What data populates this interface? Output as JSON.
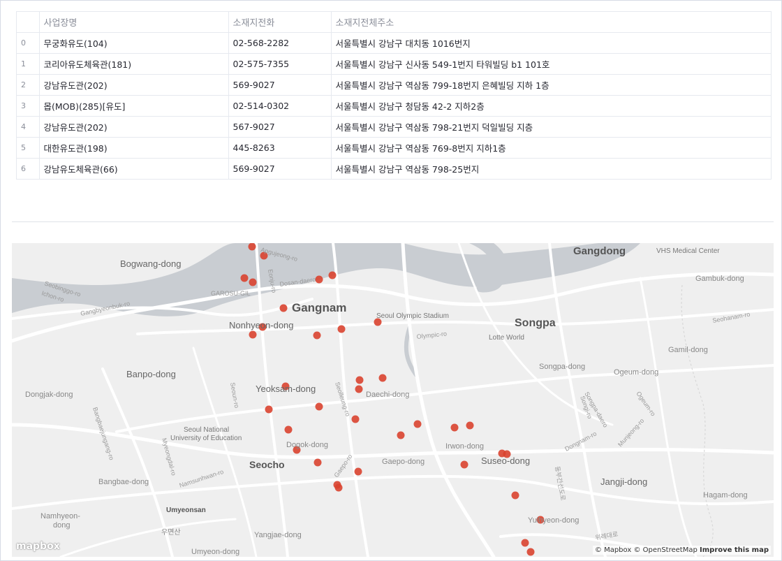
{
  "table": {
    "headers": [
      "",
      "사업장명",
      "소재지전화",
      "소재지전체주소"
    ],
    "rows": [
      {
        "idx": "0",
        "name": "무궁화유도(104)",
        "phone": "02-568-2282",
        "addr": "서울특별시 강남구 대치동 1016번지"
      },
      {
        "idx": "1",
        "name": "코리아유도체육관(181)",
        "phone": "02-575-7355",
        "addr": "서울특별시 강남구 신사동 549-1번지 타워빌딩 b1 101호"
      },
      {
        "idx": "2",
        "name": "강남유도관(202)",
        "phone": "569-9027",
        "addr": "서울특별시 강남구 역삼동 799-18번지 은혜빌딩 지하 1층"
      },
      {
        "idx": "3",
        "name": "몹(MOB)(285)[유도]",
        "phone": "02-514-0302",
        "addr": "서울특별시 강남구 청담동 42-2 지하2층"
      },
      {
        "idx": "4",
        "name": "강남유도관(202)",
        "phone": "567-9027",
        "addr": "서울특별시 강남구 역삼동 798-21번지 덕일빌딩 지층"
      },
      {
        "idx": "5",
        "name": "대한유도관(198)",
        "phone": "445-8263",
        "addr": "서울특별시 강남구 역삼동 769-8번지 지하1층"
      },
      {
        "idx": "6",
        "name": "강남유도체육관(66)",
        "phone": "569-9027",
        "addr": "서울특별시 강남구 역삼동 798-25번지"
      }
    ]
  },
  "map": {
    "colors": {
      "land": "#efefef",
      "water": "#c9cdd2",
      "road": "#ffffff",
      "marker": "#d9432f"
    },
    "place_labels": [
      {
        "text": "Gangnam",
        "size": "large"
      },
      {
        "text": "Songpa",
        "size": "large"
      },
      {
        "text": "Gangdong",
        "size": "large"
      },
      {
        "text": "Seocho",
        "size": "large"
      },
      {
        "text": "Bogwang-dong",
        "size": "medium"
      },
      {
        "text": "Nonhyeon-dong",
        "size": "medium"
      },
      {
        "text": "Banpo-dong",
        "size": "medium"
      },
      {
        "text": "Yeoksam-dong",
        "size": "medium"
      },
      {
        "text": "Suseo-dong",
        "size": "medium"
      },
      {
        "text": "Jangji-dong",
        "size": "medium"
      },
      {
        "text": "Daechi-dong",
        "size": "small"
      },
      {
        "text": "Dogok-dong",
        "size": "small"
      },
      {
        "text": "Irwon-dong",
        "size": "small"
      },
      {
        "text": "Gaepo-dong",
        "size": "small"
      },
      {
        "text": "Songpa-dong",
        "size": "small"
      },
      {
        "text": "Ogeum-dong",
        "size": "small"
      },
      {
        "text": "Gamil-dong",
        "size": "small"
      },
      {
        "text": "Gambuk-dong",
        "size": "small"
      },
      {
        "text": "Hagam-dong",
        "size": "small"
      },
      {
        "text": "Bangbae-dong",
        "size": "small"
      },
      {
        "text": "Dongjak-dong",
        "size": "small"
      },
      {
        "text": "Namhyeon-",
        "size": "small"
      },
      {
        "text": "dong",
        "size": "small"
      },
      {
        "text": "Umyeonsan",
        "size": "small"
      },
      {
        "text": "Umyeon-dong",
        "size": "small"
      },
      {
        "text": "Yangjae-dong",
        "size": "small"
      },
      {
        "text": "Yulhyeon-dong",
        "size": "small"
      },
      {
        "text": "Seoul Olympic Stadium",
        "size": "poi"
      },
      {
        "text": "Lotte World",
        "size": "poi"
      },
      {
        "text": "VHS Medical Center",
        "size": "poi"
      },
      {
        "text": "Seoul National",
        "size": "poi"
      },
      {
        "text": "University of Education",
        "size": "poi"
      },
      {
        "text": "GAROSU-GIL",
        "size": "poi"
      },
      {
        "text": "Seobinggo-ro",
        "size": "road"
      },
      {
        "text": "Ichon-ro",
        "size": "road"
      },
      {
        "text": "Gangbyeonbuk-ro",
        "size": "road"
      },
      {
        "text": "Dosan-daero",
        "size": "road"
      },
      {
        "text": "Olympic-ro",
        "size": "road"
      },
      {
        "text": "Seolleung-ro",
        "size": "road"
      },
      {
        "text": "Seoun-ro",
        "size": "road"
      },
      {
        "text": "Songpa-daero",
        "size": "road"
      },
      {
        "text": "Dongnam-ro",
        "size": "road"
      },
      {
        "text": "Namsunhwan-ro",
        "size": "road"
      },
      {
        "text": "Munjeong-ro",
        "size": "road"
      },
      {
        "text": "Seohanam-ro",
        "size": "road"
      },
      {
        "text": "Bangbaejungang-ro",
        "size": "road"
      },
      {
        "text": "Myeongdal-ro",
        "size": "road"
      },
      {
        "text": "Gaepo-ro",
        "size": "road"
      },
      {
        "text": "Ogeum-ro",
        "size": "road"
      },
      {
        "text": "Songi-ro",
        "size": "road"
      },
      {
        "text": "Apgujeong-ro",
        "size": "road"
      },
      {
        "text": "Eonju-ro",
        "size": "road"
      },
      {
        "text": "우면산",
        "size": "small"
      },
      {
        "text": "위례대로",
        "size": "road"
      },
      {
        "text": "동부간선도로",
        "size": "road"
      }
    ],
    "attribution": {
      "mapbox": "© Mapbox",
      "osm": "© OpenStreetMap",
      "improve": "Improve this map"
    },
    "logo": "mapbox"
  }
}
